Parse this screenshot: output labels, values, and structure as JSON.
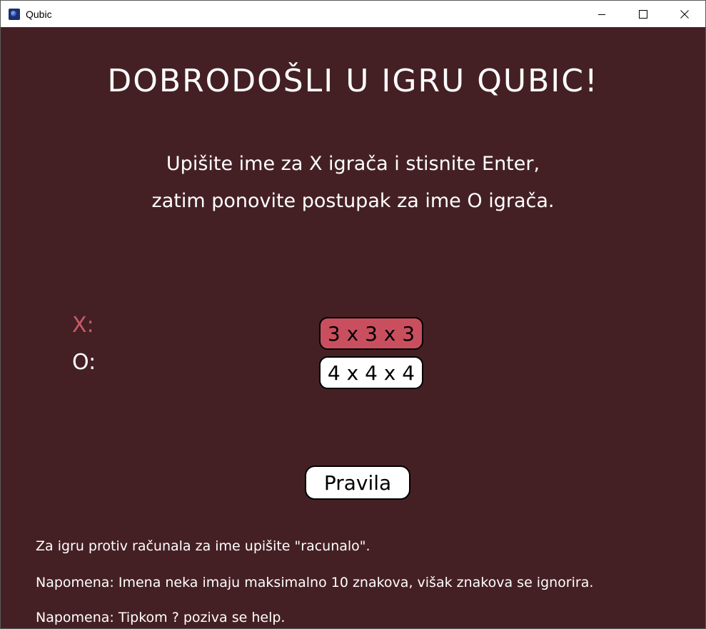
{
  "window": {
    "title": "Qubic",
    "icon": "qubic-app-icon",
    "controls": [
      "minimize-icon",
      "maximize-icon",
      "close-icon"
    ]
  },
  "colors": {
    "background": "#442024",
    "accent": "#c94f5f",
    "x_label": "#c85a66",
    "text": "#ffffff"
  },
  "main": {
    "heading": "DOBRODOŠLI U IGRU QUBIC!",
    "instruction_line1": "Upišite ime za X igrača i stisnite Enter,",
    "instruction_line2": "zatim ponovite postupak za ime O igrača."
  },
  "players": {
    "x_label": "X:",
    "o_label": "O:"
  },
  "board_sizes": {
    "selected": "3 x 3 x 3",
    "options": [
      "3 x 3 x 3",
      "4 x 4 x 4"
    ]
  },
  "rules_button": "Pravila",
  "notes": {
    "computer": "Za igru protiv računala za ime upišite \"racunalo\".",
    "name_limit": "Napomena: Imena neka imaju maksimalno 10 znakova, višak znakova se ignorira.",
    "help": "Napomena: Tipkom ? poziva se help."
  }
}
